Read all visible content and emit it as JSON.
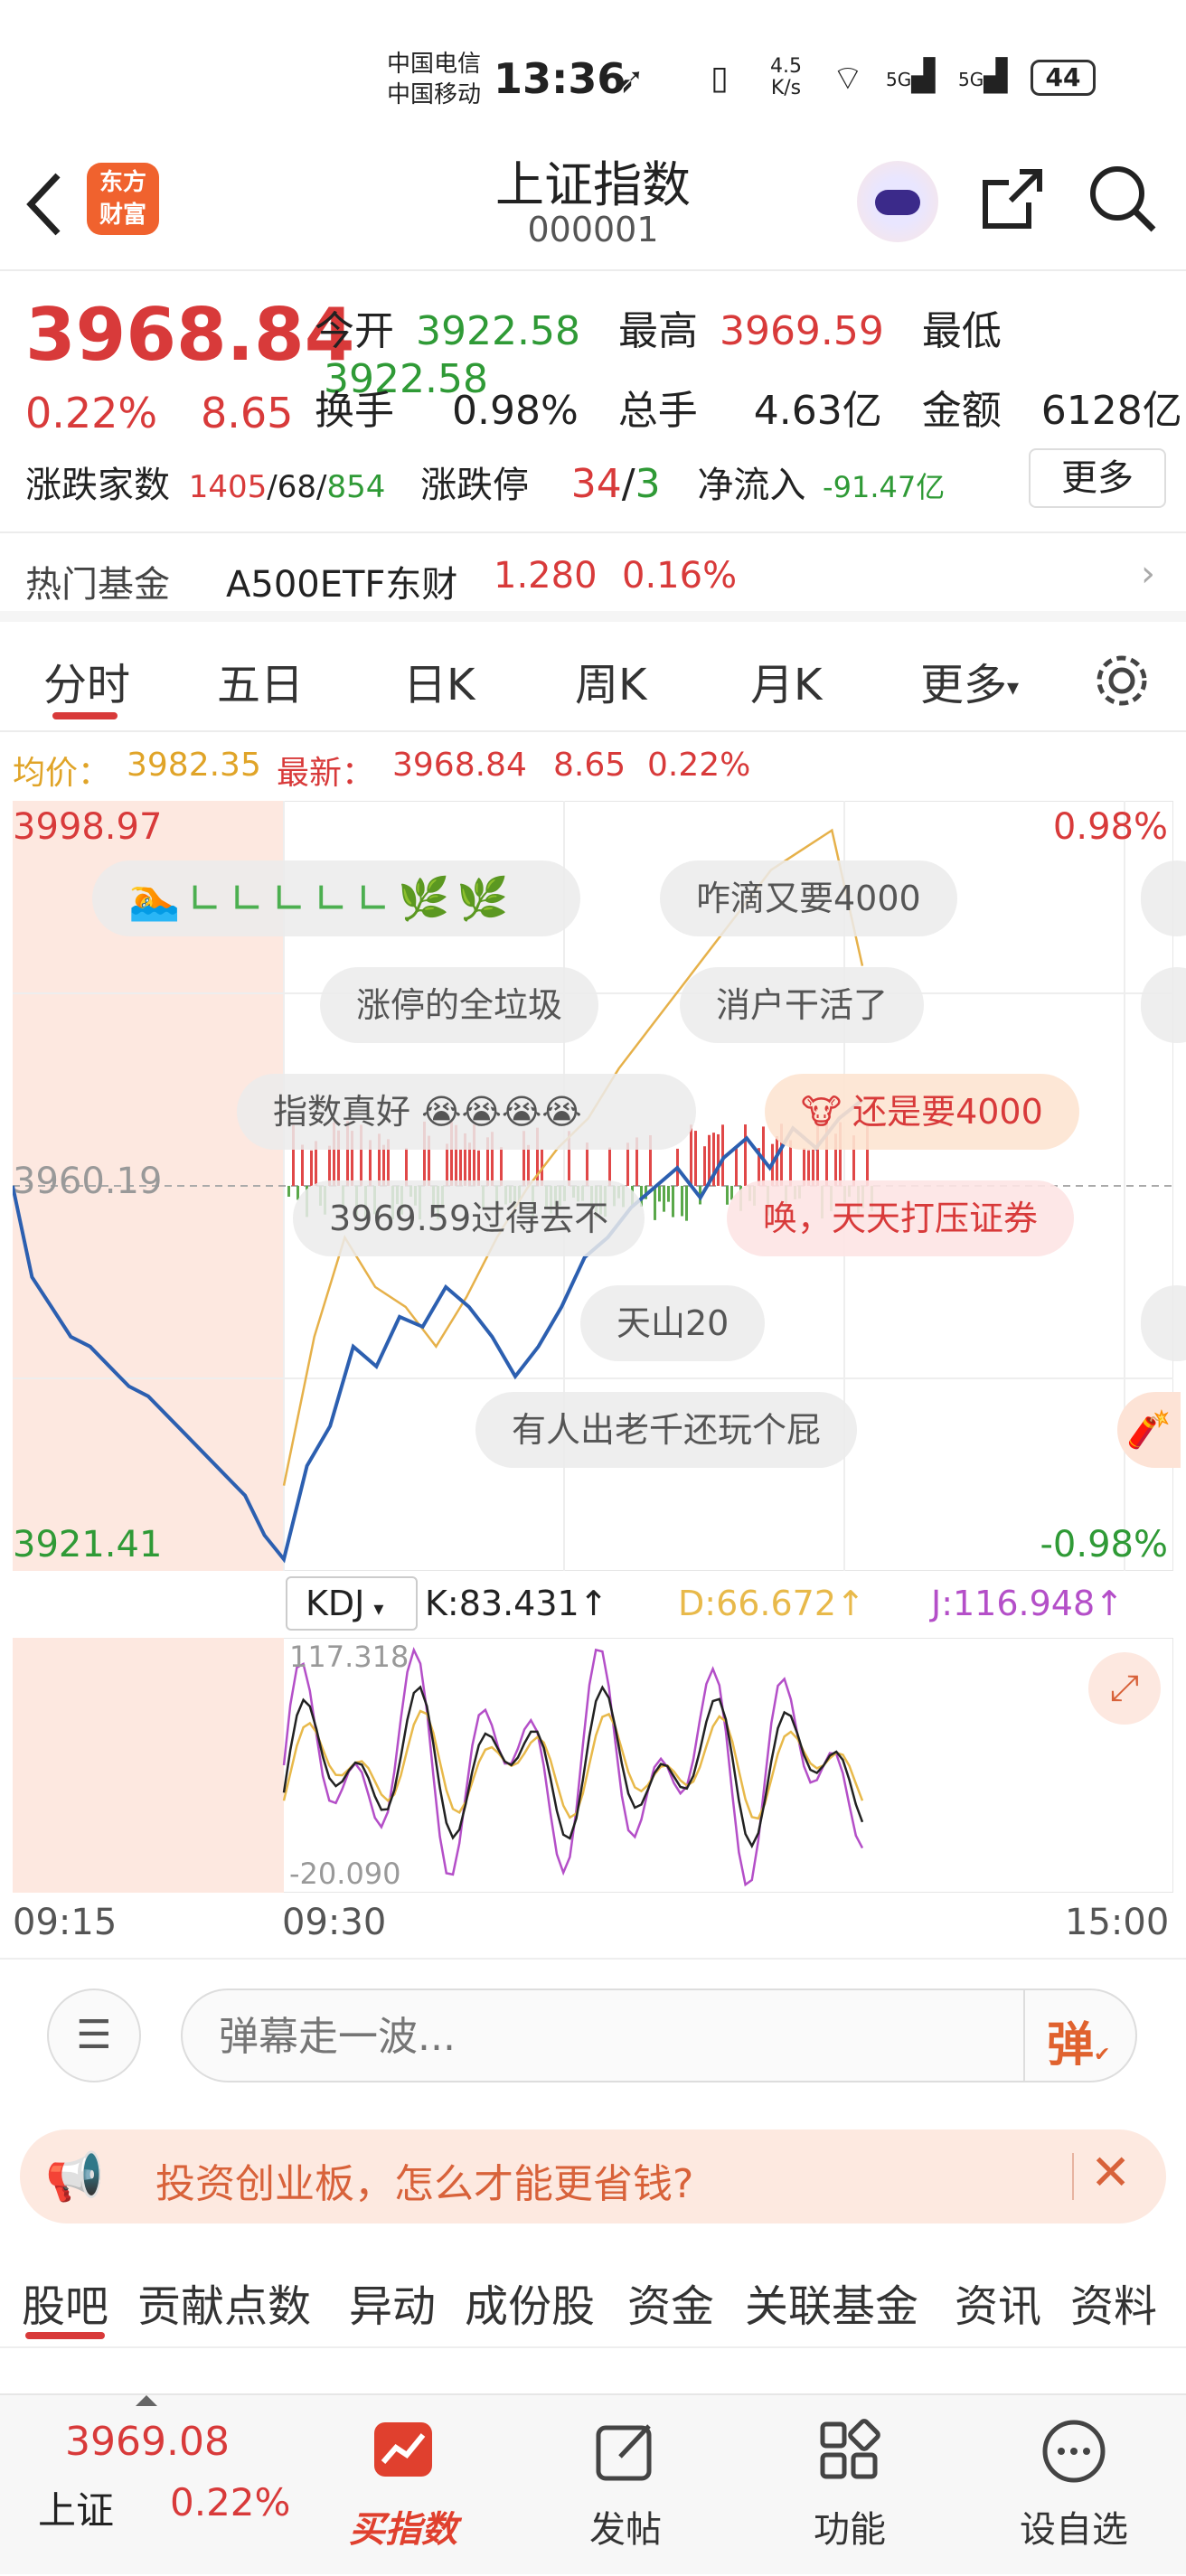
{
  "status_bar": {
    "carrier1": "中国电信",
    "carrier2": "中国移动",
    "time": "13:36",
    "net_speed_top": "4.5",
    "net_speed_bottom": "K/s",
    "sig1": "5G",
    "sig2": "5G",
    "battery": "44"
  },
  "nav": {
    "logo_line1": "东方",
    "logo_line2": "财富",
    "title": "上证指数",
    "code": "000001"
  },
  "quote": {
    "price": "3968.84",
    "pct": "0.22%",
    "change": "8.65",
    "open_label": "今开",
    "open": "3922.58",
    "high_label": "最高",
    "high": "3969.59",
    "low_label": "最低",
    "low": "3922.58",
    "turnover_label": "换手",
    "turnover": "0.98%",
    "volume_label": "总手",
    "volume": "4.63亿",
    "amount_label": "金额",
    "amount": "6128亿",
    "breadth_label": "涨跌家数",
    "up": "1405",
    "flat": "/68/",
    "down": "854",
    "limit_label": "涨跌停",
    "limit_up": "34",
    "limit_sep": "/",
    "limit_down": "3",
    "inflow_label": "净流入",
    "inflow": "-91.47亿",
    "more": "更多"
  },
  "fund": {
    "label": "热门基金",
    "name": "A500ETF东财",
    "price": "1.280",
    "pct": "0.16%"
  },
  "tabs": [
    "分时",
    "五日",
    "日K",
    "周K",
    "月K",
    "更多"
  ],
  "info": {
    "avg_label": "均价：",
    "avg": "3982.35",
    "latest_label": "最新：",
    "latest": "3968.84",
    "change": "8.65",
    "pct": "0.22%"
  },
  "chart_axis": {
    "top_price": "3998.97",
    "mid_price": "3960.19",
    "bottom_price": "3921.41",
    "top_pct": "0.98%",
    "bottom_pct": "-0.98%"
  },
  "danmaku": [
    "咋滴又要4000",
    "涨停的全垃圾",
    "消户干活了",
    "指数真好",
    "还是要4000",
    "3969.59过得去不",
    "唤，天天打压证券",
    "天山20",
    "有人出老千还玩个屁"
  ],
  "kdj": {
    "name": "KDJ",
    "k": "K:83.431↑",
    "d": "D:66.672↑",
    "j": "J:116.948↑",
    "max": "117.318",
    "min": "-20.090"
  },
  "time_axis": {
    "t1": "09:15",
    "t2": "09:30",
    "t3": "15:00"
  },
  "danmu_input": {
    "placeholder": "弹幕走一波...",
    "send": "弹"
  },
  "promo": {
    "text": "投资创业板，怎么才能更省钱?"
  },
  "sub_tabs": [
    "股吧",
    "贡献点数",
    "异动",
    "成份股",
    "资金",
    "关联基金",
    "资讯",
    "资料"
  ],
  "bottom": {
    "mini_price": "3969.08",
    "mini_name": "上证",
    "mini_pct": "0.22%",
    "buy": "买指数",
    "post": "发帖",
    "func": "功能",
    "watch": "设自选"
  },
  "chart_data": {
    "type": "line",
    "title": "",
    "x_range": [
      "09:15",
      "15:00"
    ],
    "ylim": [
      3921.41,
      3998.97
    ],
    "reference_price": 3960.19,
    "series": [
      {
        "name": "",
        "values": [
          3960.19,
          3951,
          3948,
          3945,
          3944,
          3942,
          3940,
          3939,
          3937,
          3935,
          3933,
          3931,
          3929,
          3925,
          3922.58,
          3932,
          3936,
          3944,
          3942,
          3947,
          3946,
          3950,
          3948,
          3945,
          3941,
          3944,
          3948,
          3953,
          3955,
          3958,
          3960,
          3962,
          3959,
          3963,
          3965,
          3962,
          3966,
          3964,
          3967,
          3968.84
        ]
      },
      {
        "name": "均价",
        "values": [
          3930,
          3945,
          3955,
          3950,
          3948,
          3944,
          3949,
          3955,
          3960,
          3964,
          3967,
          3972,
          3976,
          3980,
          3984,
          3988,
          3992,
          3994,
          3996,
          3982.35
        ]
      }
    ],
    "kdj_range": [
      -20.09,
      117.318
    ]
  }
}
